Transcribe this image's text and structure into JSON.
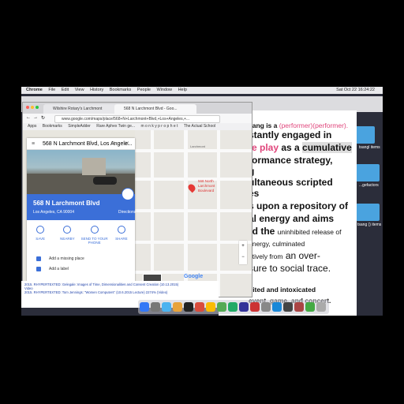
{
  "menubar": {
    "items": [
      "Chrome",
      "File",
      "Edit",
      "View",
      "History",
      "Bookmarks",
      "People",
      "Window",
      "Help"
    ],
    "clock": "Sat Oct 22  16:24:22"
  },
  "browser": {
    "tabs": [
      "Wilshire Rotary's Larchmont",
      "568 N Larchmont Blvd - Goo..."
    ],
    "url": "www.google.com/maps/place/568+N+Larchmont+Blvd,+Los+Angeles,+...",
    "bookmarks": [
      "Apps",
      "Bookmarks",
      "SimpleAdder",
      "Rare Aphex Twin ge...",
      "m o n k y p r o p h e t",
      "The Actual School"
    ]
  },
  "maps": {
    "search_value": "568 N Larchmont Blvd, Los Angele...",
    "place_name": "568 N Larchmont Blvd",
    "place_address": "Los Angeles, CA 90004",
    "directions_label": "Directions",
    "actions": [
      "SAVE",
      "NEARBY",
      "SEND TO YOUR PHONE",
      "SHARE"
    ],
    "add_missing_place": "Add a missing place",
    "add_label": "Add a label",
    "pin_label": "568 North Larchmont Boulevard",
    "earth_label": "Earth",
    "street_label_1": "Larchmont",
    "google_logo": "Google"
  },
  "document": {
    "lines": [
      "sang is a (performer)(performer).",
      "stantly engaged in",
      "te play as a cumulative",
      "formance strategy,",
      "g",
      "ultaneous scripted",
      "es",
      "s upon a repository of",
      "al energy and aims",
      "rd the uninhibited release of",
      "energy, culminated",
      "atively from an over-",
      "sure to social trace.",
      "bited and intoxicated",
      "event, game, and concert."
    ]
  },
  "desktop": {
    "folder_labels": [
      "tsangl items",
      "...gefactors",
      "tsang () items"
    ]
  },
  "footer_links": [
    "2015. RHYPERTEXTED: Gelegale: Images of Time, Dimensionalities and Consent Creation (10.13.2015)",
    "Video",
    "2015. RHYPERTEXTED: Tom Jennings: \"Women Computers\" (10.6.2015 Lecture) 2274% (Video)"
  ]
}
